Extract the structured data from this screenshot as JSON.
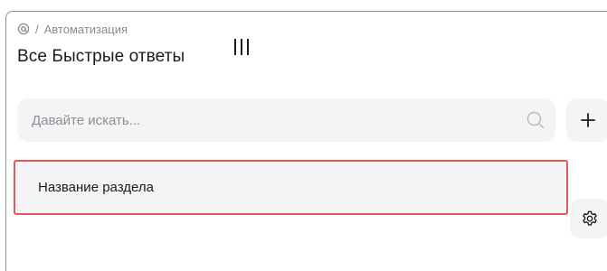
{
  "breadcrumb": {
    "icon": "at-sign-icon",
    "separator": "/",
    "current": "Автоматизация"
  },
  "page": {
    "title": "Все Быстрые ответы",
    "title_menu_icon": "vertical-bars-icon"
  },
  "search": {
    "placeholder": "Давайте искать...",
    "value": "",
    "icon": "search-icon"
  },
  "actions": {
    "add_icon": "plus-icon",
    "settings_icon": "gear-icon"
  },
  "sections": [
    {
      "label": "Название раздела"
    }
  ],
  "colors": {
    "panel_border": "#8f8f8f",
    "surface": "#f4f4f6",
    "selected_border": "#e05a5a",
    "text": "#1c1c1e",
    "muted_text": "#8a8a8e"
  }
}
